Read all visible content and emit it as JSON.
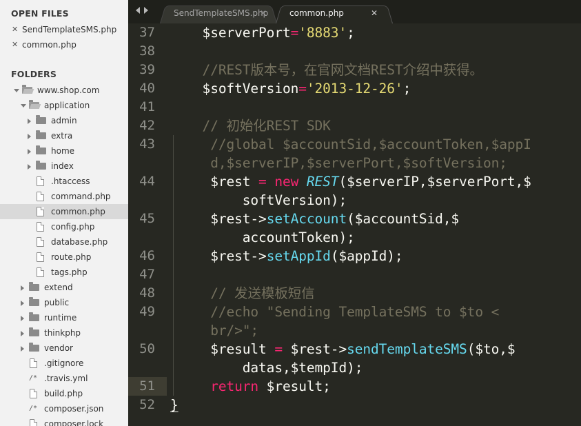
{
  "sidebar": {
    "open_files_header": "OPEN FILES",
    "folders_header": "FOLDERS",
    "open_files": [
      "SendTemplateSMS.php",
      "common.php"
    ],
    "close_glyph": "✕",
    "tree": [
      {
        "label": "www.shop.com",
        "type": "folder",
        "depth": 0,
        "expanded": true,
        "icon": "folder-open-icon"
      },
      {
        "label": "application",
        "type": "folder",
        "depth": 1,
        "expanded": true,
        "icon": "folder-open-icon"
      },
      {
        "label": "admin",
        "type": "folder",
        "depth": 2,
        "expanded": false,
        "icon": "folder-icon"
      },
      {
        "label": "extra",
        "type": "folder",
        "depth": 2,
        "expanded": false,
        "icon": "folder-icon"
      },
      {
        "label": "home",
        "type": "folder",
        "depth": 2,
        "expanded": false,
        "icon": "folder-icon"
      },
      {
        "label": "index",
        "type": "folder",
        "depth": 2,
        "expanded": false,
        "icon": "folder-icon"
      },
      {
        "label": ".htaccess",
        "type": "file",
        "depth": 2,
        "icon": "file-icon"
      },
      {
        "label": "command.php",
        "type": "file",
        "depth": 2,
        "icon": "file-icon"
      },
      {
        "label": "common.php",
        "type": "file",
        "depth": 2,
        "icon": "file-icon",
        "selected": true
      },
      {
        "label": "config.php",
        "type": "file",
        "depth": 2,
        "icon": "file-icon"
      },
      {
        "label": "database.php",
        "type": "file",
        "depth": 2,
        "icon": "file-icon"
      },
      {
        "label": "route.php",
        "type": "file",
        "depth": 2,
        "icon": "file-icon"
      },
      {
        "label": "tags.php",
        "type": "file",
        "depth": 2,
        "icon": "file-icon"
      },
      {
        "label": "extend",
        "type": "folder",
        "depth": 1,
        "expanded": false,
        "icon": "folder-icon"
      },
      {
        "label": "public",
        "type": "folder",
        "depth": 1,
        "expanded": false,
        "icon": "folder-icon"
      },
      {
        "label": "runtime",
        "type": "folder",
        "depth": 1,
        "expanded": false,
        "icon": "folder-icon"
      },
      {
        "label": "thinkphp",
        "type": "folder",
        "depth": 1,
        "expanded": false,
        "icon": "folder-icon"
      },
      {
        "label": "vendor",
        "type": "folder",
        "depth": 1,
        "expanded": false,
        "icon": "folder-icon"
      },
      {
        "label": ".gitignore",
        "type": "file",
        "depth": 1,
        "icon": "file-icon"
      },
      {
        "label": ".travis.yml",
        "type": "comment-file",
        "depth": 1,
        "icon": "comment-file-icon",
        "glyph": "/*"
      },
      {
        "label": "build.php",
        "type": "file",
        "depth": 1,
        "icon": "file-icon"
      },
      {
        "label": "composer.json",
        "type": "comment-file",
        "depth": 1,
        "icon": "comment-file-icon",
        "glyph": "/*"
      },
      {
        "label": "composer.lock",
        "type": "file",
        "depth": 1,
        "icon": "file-icon"
      }
    ]
  },
  "tabs": [
    {
      "label": "SendTemplateSMS.php",
      "active": false,
      "close": "✕"
    },
    {
      "label": "common.php",
      "active": true,
      "close": "✕"
    }
  ],
  "editor": {
    "active_line": "51",
    "lines": [
      {
        "num": "37",
        "rows": [
          [
            [
              "p",
              "    $serverPort"
            ],
            [
              "o",
              "="
            ],
            [
              "s",
              "'8883'"
            ],
            [
              "p",
              ";"
            ]
          ]
        ]
      },
      {
        "num": "38",
        "rows": [
          []
        ]
      },
      {
        "num": "39",
        "rows": [
          [
            [
              "c",
              "    //REST版本号，在官网文档REST介绍中获得。"
            ]
          ]
        ]
      },
      {
        "num": "40",
        "rows": [
          [
            [
              "p",
              "    $softVersion"
            ],
            [
              "o",
              "="
            ],
            [
              "s",
              "'2013-12-26'"
            ],
            [
              "p",
              ";"
            ]
          ]
        ]
      },
      {
        "num": "41",
        "rows": [
          []
        ]
      },
      {
        "num": "42",
        "rows": [
          [
            [
              "c",
              "    // 初始化REST SDK"
            ]
          ]
        ]
      },
      {
        "num": "43",
        "rows": [
          [
            [
              "c",
              "     //global $accountSid,$accountToken,$appI"
            ]
          ],
          [
            [
              "c",
              "     d,$serverIP,$serverPort,$softVersion;"
            ]
          ]
        ]
      },
      {
        "num": "44",
        "rows": [
          [
            [
              "p",
              "     $rest "
            ],
            [
              "o",
              "="
            ],
            [
              "p",
              " "
            ],
            [
              "k",
              "new"
            ],
            [
              "p",
              " "
            ],
            [
              "t",
              "REST"
            ],
            [
              "p",
              "($serverIP,$serverPort,$"
            ]
          ],
          [
            [
              "p",
              "         softVersion);"
            ]
          ]
        ]
      },
      {
        "num": "45",
        "rows": [
          [
            [
              "p",
              "     $rest->"
            ],
            [
              "f",
              "setAccount"
            ],
            [
              "p",
              "($accountSid,$"
            ]
          ],
          [
            [
              "p",
              "         accountToken);"
            ]
          ]
        ]
      },
      {
        "num": "46",
        "rows": [
          [
            [
              "p",
              "     $rest->"
            ],
            [
              "f",
              "setAppId"
            ],
            [
              "p",
              "($appId);"
            ]
          ]
        ]
      },
      {
        "num": "47",
        "rows": [
          []
        ]
      },
      {
        "num": "48",
        "rows": [
          [
            [
              "c",
              "     // 发送模板短信"
            ]
          ]
        ]
      },
      {
        "num": "49",
        "rows": [
          [
            [
              "c",
              "     //echo \"Sending TemplateSMS to $to <"
            ]
          ],
          [
            [
              "c",
              "     br/>\";"
            ]
          ]
        ]
      },
      {
        "num": "50",
        "rows": [
          [
            [
              "p",
              "     $result "
            ],
            [
              "o",
              "="
            ],
            [
              "p",
              " $rest->"
            ],
            [
              "f",
              "sendTemplateSMS"
            ],
            [
              "p",
              "($to,$"
            ]
          ],
          [
            [
              "p",
              "         datas,$tempId);"
            ]
          ]
        ]
      },
      {
        "num": "51",
        "rows": [
          [
            [
              "k",
              "     return"
            ],
            [
              "p",
              " $result;"
            ]
          ]
        ]
      },
      {
        "num": "52",
        "rows": [
          [
            [
              "u",
              "}"
            ]
          ]
        ]
      }
    ]
  },
  "colors": {
    "background": "#272822",
    "sidebar": "#f2f2f2",
    "string": "#e6db74",
    "keyword": "#f92672",
    "function": "#66d9ef",
    "comment": "#75715e"
  }
}
